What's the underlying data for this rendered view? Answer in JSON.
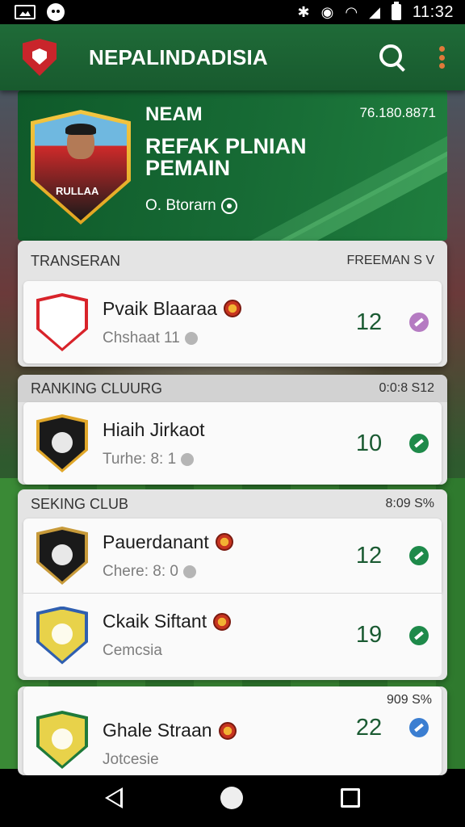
{
  "status_bar": {
    "time": "11:32"
  },
  "app_bar": {
    "title": "NEPALINDADISIA"
  },
  "hero": {
    "label": "NEAM",
    "headline": "REFAK PLNIAN PEMAIN",
    "sub": "O. Btorarn",
    "stat": "76.180.8871",
    "jersey": "RULLAA"
  },
  "sections": [
    {
      "title": "TRANSERAN",
      "meta": "FREEMAN S V",
      "clubs": [
        {
          "name": "Pvaik Blaaraa",
          "meta": "Chshaat 11",
          "score": "12",
          "status_color": "#b57bc2",
          "crest_colors": [
            "#d8232a",
            "#ffffff"
          ]
        }
      ]
    },
    {
      "title": "RANKING CLUURG",
      "meta": "0:0:8 S12",
      "clubs": [
        {
          "name": "Hiaih Jirkaot",
          "meta": "Turhe: 8: 1",
          "score": "10",
          "status_color": "#1e8a4a",
          "crest_colors": [
            "#e0a72a",
            "#1a1a1a"
          ]
        }
      ]
    },
    {
      "title": "SEKING CLUB",
      "meta": "8:09 S%",
      "clubs": [
        {
          "name": "Pauerdanant",
          "meta": "Chere: 8: 0",
          "score": "12",
          "status_color": "#1e8a4a",
          "crest_colors": [
            "#c79a3a",
            "#1a1a1a"
          ]
        },
        {
          "name": "Ckaik Siftant",
          "meta": "Cemcsia",
          "score": "19",
          "status_color": "#1e8a4a",
          "crest_colors": [
            "#2f5fb0",
            "#e8d24a"
          ]
        }
      ]
    },
    {
      "title": "",
      "meta": "909 S%",
      "clubs": [
        {
          "name": "Ghale Straan",
          "meta": "Jotcesie",
          "score": "22",
          "status_color": "#3b7ed1",
          "crest_colors": [
            "#1f7a3a",
            "#e8d24a"
          ]
        }
      ]
    }
  ]
}
